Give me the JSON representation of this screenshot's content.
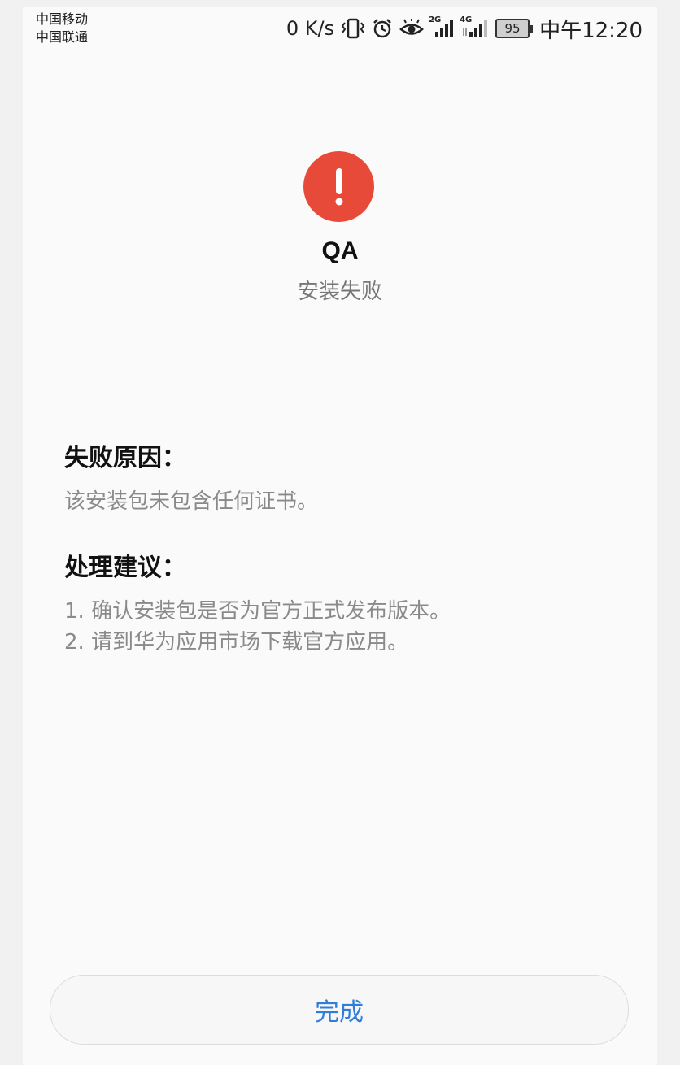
{
  "status_bar": {
    "carrier_1": "中国移动",
    "carrier_2": "中国联通",
    "net_speed": "0 K/s",
    "signal_1_type": "2G",
    "signal_2_type": "4G",
    "battery_level": "95",
    "time": "中午12:20"
  },
  "app": {
    "name": "QA",
    "status": "安装失败",
    "alert_icon": "exclamation-icon",
    "alert_color": "#e84a3a"
  },
  "failure": {
    "title": "失败原因：",
    "text": "该安装包未包含任何证书。"
  },
  "suggestion": {
    "title": "处理建议：",
    "lines": [
      "1. 确认安装包是否为官方正式发布版本。",
      "2. 请到华为应用市场下载官方应用。"
    ]
  },
  "button": {
    "label": "完成",
    "color": "#2f7ed8"
  }
}
